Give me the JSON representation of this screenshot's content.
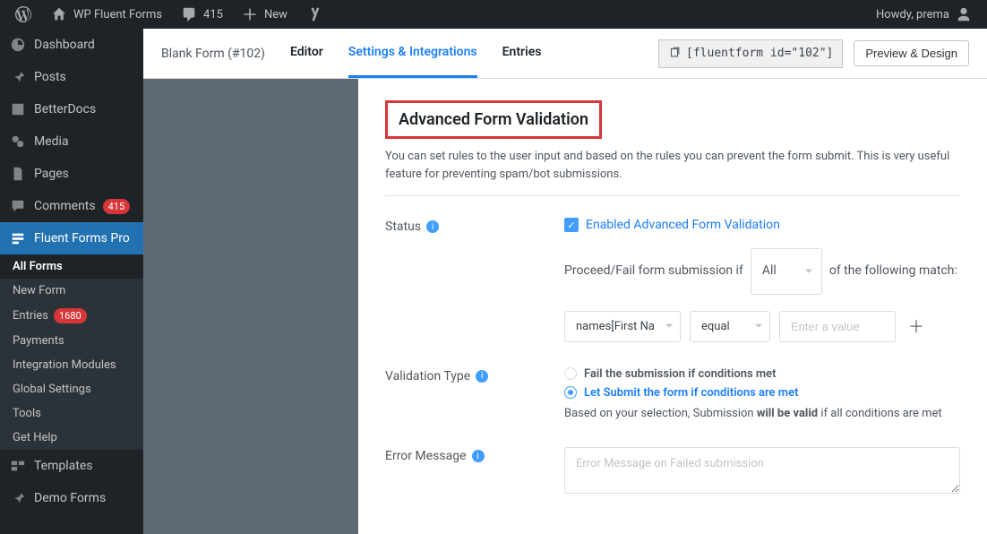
{
  "adminbar": {
    "site_name": "WP Fluent Forms",
    "comments_count": "415",
    "new_label": "New",
    "howdy": "Howdy, prema"
  },
  "sidebar": {
    "items": [
      {
        "label": "Dashboard"
      },
      {
        "label": "Posts"
      },
      {
        "label": "BetterDocs"
      },
      {
        "label": "Media"
      },
      {
        "label": "Pages"
      },
      {
        "label": "Comments",
        "badge": "415"
      },
      {
        "label": "Fluent Forms Pro"
      },
      {
        "label": "Templates"
      },
      {
        "label": "Demo Forms"
      }
    ],
    "submenu": [
      {
        "label": "All Forms"
      },
      {
        "label": "New Form"
      },
      {
        "label": "Entries",
        "badge": "1680"
      },
      {
        "label": "Payments"
      },
      {
        "label": "Integration Modules"
      },
      {
        "label": "Global Settings"
      },
      {
        "label": "Tools"
      },
      {
        "label": "Get Help"
      }
    ]
  },
  "topbar": {
    "form_name": "Blank Form (#102)",
    "tabs": {
      "editor": "Editor",
      "settings": "Settings & Integrations",
      "entries": "Entries"
    },
    "shortcode": "[fluentform id=\"102\"]",
    "preview_btn": "Preview & Design"
  },
  "section": {
    "title": "Advanced Form Validation",
    "desc": "You can set rules to the user input and based on the rules you can prevent the form submit. This is very useful feature for preventing spam/bot submissions."
  },
  "status": {
    "label": "Status",
    "checkbox_label": "Enabled Advanced Form Validation",
    "sentence_pre": "Proceed/Fail form submission if",
    "select_all": "All",
    "sentence_post": "of the following match:",
    "cond_field": "names[First Na",
    "cond_op": "equal",
    "cond_value_placeholder": "Enter a value"
  },
  "validation_type": {
    "label": "Validation Type",
    "opt_fail": "Fail the submission if conditions met",
    "opt_pass": "Let Submit the form if conditions are met",
    "note_pre": "Based on your selection, Submission ",
    "note_bold": "will be valid",
    "note_post": " if all conditions are met"
  },
  "error_msg": {
    "label": "Error Message",
    "placeholder": "Error Message on Failed submission"
  }
}
